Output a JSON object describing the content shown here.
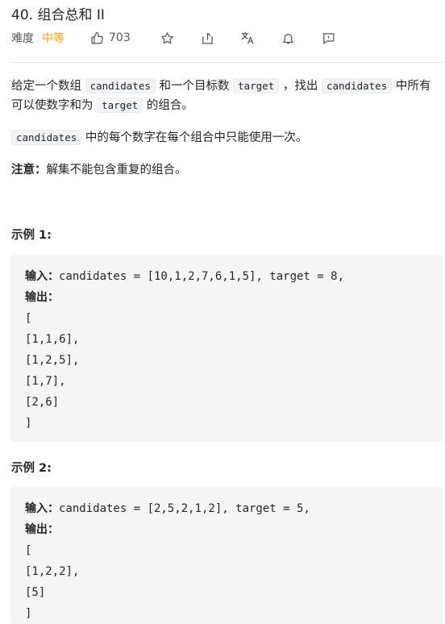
{
  "problem": {
    "number": "40.",
    "title": "组合总和 II"
  },
  "meta": {
    "difficulty_label": "难度",
    "difficulty_value": "中等",
    "likes": "703"
  },
  "description": {
    "p1_a": "给定一个数组",
    "p1_code1": "candidates",
    "p1_b": "和一个目标数",
    "p1_code2": "target",
    "p1_c": "，找出",
    "p1_code3": "candidates",
    "p1_d": "中所有可以使数字和为",
    "p1_code4": "target",
    "p1_e": "的组合。",
    "p2_code": "candidates",
    "p2_text": "中的每个数字在每个组合中只能使用一次。",
    "note_label": "注意：",
    "note_text": "解集不能包含重复的组合。"
  },
  "examples": [
    {
      "heading": "示例 1:",
      "input_label": "输入：",
      "input_value": "candidates = [10,1,2,7,6,1,5], target = 8,",
      "output_label": "输出：",
      "output_lines": [
        "[",
        "[1,1,6],",
        "[1,2,5],",
        "[1,7],",
        "[2,6]",
        "]"
      ]
    },
    {
      "heading": "示例 2:",
      "input_label": "输入：",
      "input_value": "candidates = [2,5,2,1,2], target = 5,",
      "output_label": "输出：",
      "output_lines": [
        "[",
        "[1,2,2],",
        "[5]",
        "]"
      ]
    }
  ]
}
